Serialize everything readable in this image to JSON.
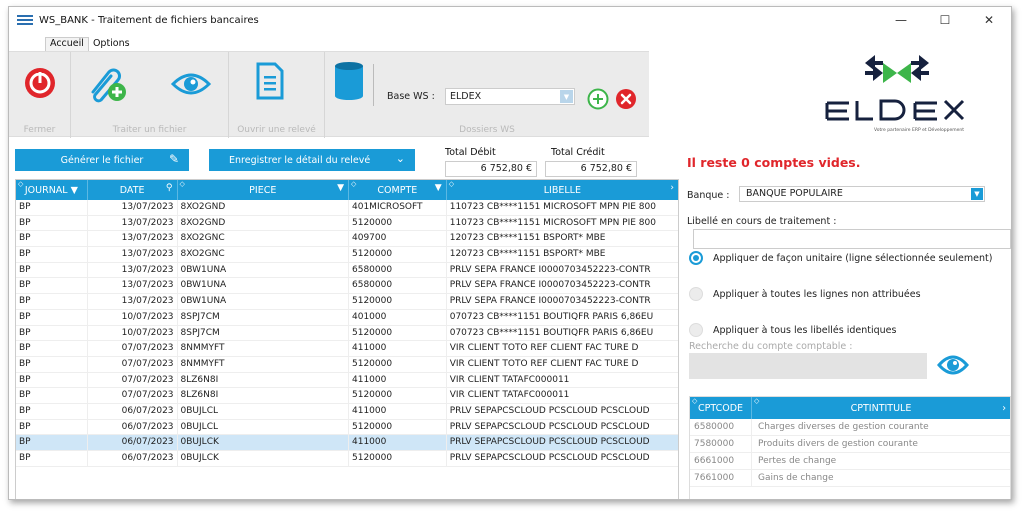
{
  "window": {
    "title": "WS_BANK - Traitement de fichiers bancaires",
    "minimize": "—",
    "maximize": "☐",
    "close": "✕"
  },
  "menu": [
    "Accueil",
    "Options"
  ],
  "ribbon": {
    "groups": [
      "Fermer",
      "Traiter un fichier",
      "Ouvrir une relevé",
      "Dossiers WS"
    ],
    "base_ws_label": "Base WS :",
    "base_ws_value": "ELDEX",
    "accent": "#1a9bd7",
    "danger": "#e0262b",
    "success": "#3db54a"
  },
  "logo": {
    "text": "ELDEX",
    "tagline": "Votre partenaire ERP et Développement"
  },
  "actions": {
    "generate": "Générer le fichier",
    "save_detail": "Enregistrer le détail du relevé",
    "total_debit_label": "Total Débit",
    "total_credit_label": "Total Crédit",
    "total_debit": "6 752,80 €",
    "total_credit": "6 752,80 €"
  },
  "grid": {
    "columns": [
      "JOURNAL",
      "DATE",
      "PIECE",
      "COMPTE",
      "LIBELLE"
    ],
    "rows": [
      [
        "BP",
        "13/07/2023",
        "8XO2GND",
        "401MICROSOFT",
        "110723 CB****1151 MICROSOFT MPN PIE 800"
      ],
      [
        "BP",
        "13/07/2023",
        "8XO2GND",
        "5120000",
        "110723 CB****1151 MICROSOFT MPN PIE 800"
      ],
      [
        "BP",
        "13/07/2023",
        "8XO2GNC",
        "409700",
        "120723 CB****1151 BSPORT* MBE"
      ],
      [
        "BP",
        "13/07/2023",
        "8XO2GNC",
        "5120000",
        "120723 CB****1151 BSPORT* MBE"
      ],
      [
        "BP",
        "13/07/2023",
        "0BW1UNA",
        "6580000",
        "PRLV SEPA FRANCE I0000703452223-CONTR"
      ],
      [
        "BP",
        "13/07/2023",
        "0BW1UNA",
        "6580000",
        "PRLV SEPA FRANCE I0000703452223-CONTR"
      ],
      [
        "BP",
        "13/07/2023",
        "0BW1UNA",
        "5120000",
        "PRLV SEPA FRANCE I0000703452223-CONTR"
      ],
      [
        "BP",
        "10/07/2023",
        "8SPJ7CM",
        "401000",
        "070723 CB****1151 BOUTIQFR PARIS 6,86EU"
      ],
      [
        "BP",
        "10/07/2023",
        "8SPJ7CM",
        "5120000",
        "070723 CB****1151 BOUTIQFR PARIS 6,86EU"
      ],
      [
        "BP",
        "07/07/2023",
        "8NMMYFT",
        "411000",
        "VIR CLIENT TOTO REF  CLIENT  FAC TURE  D"
      ],
      [
        "BP",
        "07/07/2023",
        "8NMMYFT",
        "5120000",
        "VIR CLIENT TOTO REF  CLIENT  FAC TURE  D"
      ],
      [
        "BP",
        "07/07/2023",
        "8LZ6N8I",
        "411000",
        "VIR CLIENT TATAFC000011"
      ],
      [
        "BP",
        "07/07/2023",
        "8LZ6N8I",
        "5120000",
        "VIR CLIENT TATAFC000011"
      ],
      [
        "BP",
        "06/07/2023",
        "0BUJLCL",
        "411000",
        "PRLV SEPAPCSCLOUD PCSCLOUD PCSCLOUD"
      ],
      [
        "BP",
        "06/07/2023",
        "0BUJLCL",
        "5120000",
        "PRLV SEPAPCSCLOUD PCSCLOUD PCSCLOUD"
      ],
      [
        "BP",
        "06/07/2023",
        "0BUJLCK",
        "411000",
        "PRLV SEPAPCSCLOUD PCSCLOUD PCSCLOUD"
      ],
      [
        "BP",
        "06/07/2023",
        "0BUJLCK",
        "5120000",
        "PRLV SEPAPCSCLOUD PCSCLOUD PCSCLOUD"
      ]
    ]
  },
  "panel": {
    "warning": "Il reste 0 comptes vides.",
    "bank_label": "Banque :",
    "bank_value": "BANQUE POPULAIRE",
    "libelle_label": "Libellé en cours de traitement :",
    "radios": [
      "Appliquer de façon unitaire (ligne sélectionnée seulement)",
      "Appliquer à toutes les lignes non attribuées",
      "Appliquer à tous les libellés identiques"
    ],
    "search_label": "Recherche du compte comptable :"
  },
  "accounts": {
    "columns": [
      "CPTCODE",
      "CPTINTITULE"
    ],
    "rows": [
      [
        "6580000",
        "Charges diverses de gestion courante"
      ],
      [
        "7580000",
        "Produits divers de gestion courante"
      ],
      [
        "6661000",
        "Pertes de change"
      ],
      [
        "7661000",
        "Gains de change"
      ]
    ]
  }
}
